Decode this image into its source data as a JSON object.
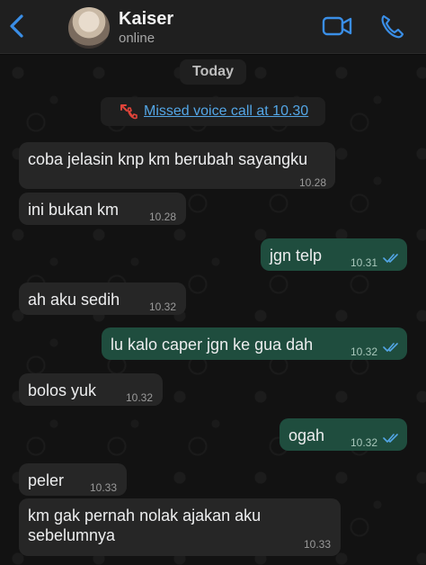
{
  "header": {
    "name": "Kaiser",
    "status": "online",
    "icons": {
      "back": "chevron-left-icon",
      "video": "video-call-icon",
      "phone": "voice-call-icon"
    },
    "accent_color": "#3a8ee6"
  },
  "chat": {
    "date_label": "Today",
    "missed_call": "Missed voice call at 10.30",
    "messages": [
      {
        "dir": "in",
        "text": "coba jelasin knp km berubah sayangku",
        "time": "10.28"
      },
      {
        "dir": "in",
        "text": "ini bukan km",
        "time": "10.28"
      },
      {
        "dir": "out",
        "text": "jgn telp",
        "time": "10.31",
        "read": true
      },
      {
        "dir": "in",
        "text": "ah aku sedih",
        "time": "10.32"
      },
      {
        "dir": "out",
        "text": "lu kalo caper jgn ke gua dah",
        "time": "10.32",
        "read": true
      },
      {
        "dir": "in",
        "text": "bolos yuk",
        "time": "10.32"
      },
      {
        "dir": "out",
        "text": "ogah",
        "time": "10.32",
        "read": true
      },
      {
        "dir": "in",
        "text": "peler",
        "time": "10.33"
      },
      {
        "dir": "in",
        "text_line1": "km gak pernah nolak ajakan aku",
        "text_line2": "sebelumnya",
        "time": "10.33"
      }
    ],
    "colors": {
      "incoming": "#262626",
      "outgoing": "#1f4d3e",
      "read_ticks": "#53a6e6",
      "missed_call": "#e0443a"
    }
  }
}
